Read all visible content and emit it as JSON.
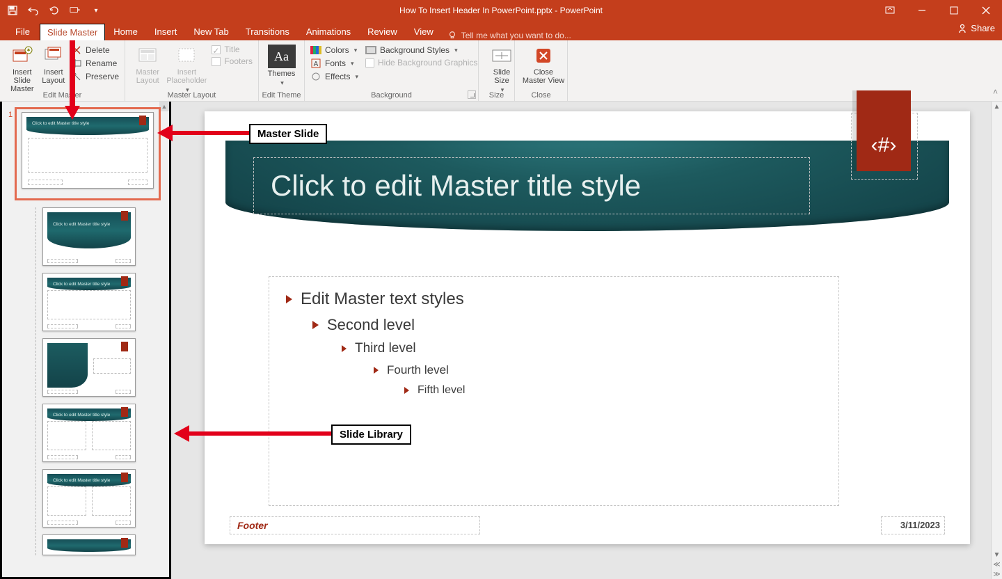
{
  "app": {
    "title": "How To Insert Header In PowerPoint.pptx - PowerPoint"
  },
  "qat_icons": [
    "save-icon",
    "undo-icon",
    "redo-icon",
    "start-from-beginning-icon",
    "customize-qat-icon"
  ],
  "tabs": {
    "file": "File",
    "slide_master": "Slide Master",
    "home": "Home",
    "insert": "Insert",
    "new_tab": "New Tab",
    "transitions": "Transitions",
    "animations": "Animations",
    "review": "Review",
    "view": "View",
    "tellme": "Tell me what you want to do..."
  },
  "share": "Share",
  "ribbon": {
    "edit_master": {
      "insert_slide_master": "Insert Slide\nMaster",
      "insert_layout": "Insert\nLayout",
      "delete": "Delete",
      "rename": "Rename",
      "preserve": "Preserve",
      "group": "Edit Master"
    },
    "master_layout": {
      "master_layout": "Master\nLayout",
      "insert_placeholder": "Insert\nPlaceholder",
      "title": "Title",
      "footers": "Footers",
      "group": "Master Layout"
    },
    "edit_theme": {
      "themes": "Themes",
      "group": "Edit Theme"
    },
    "background": {
      "colors": "Colors",
      "fonts": "Fonts",
      "effects": "Effects",
      "bg_styles": "Background Styles",
      "hide_bg": "Hide Background Graphics",
      "group": "Background"
    },
    "size": {
      "slide_size": "Slide\nSize",
      "group": "Size"
    },
    "close": {
      "close_master": "Close\nMaster View",
      "group": "Close"
    }
  },
  "thumbs": {
    "master_number": "1",
    "title_text": "Click to edit Master title style"
  },
  "slide": {
    "title": "Click to edit Master title style",
    "page_badge": "‹#›",
    "levels": {
      "l1": "Edit Master text styles",
      "l2": "Second level",
      "l3": "Third level",
      "l4": "Fourth level",
      "l5": "Fifth level"
    },
    "footer": "Footer",
    "date": "3/11/2023"
  },
  "annotations": {
    "master_slide": "Master Slide",
    "slide_library": "Slide Library"
  }
}
